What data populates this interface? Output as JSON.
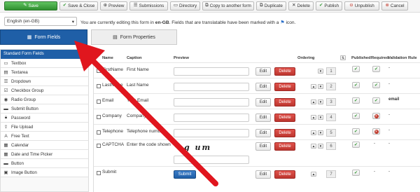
{
  "toolbar": {
    "save": "Save",
    "save_close": "Save & Close",
    "preview": "Preview",
    "submissions": "Submissions",
    "directory": "Directory",
    "copy": "Copy to another form",
    "duplicate": "Duplicate",
    "delete": "Delete",
    "publish": "Publish",
    "unpublish": "Unpublish",
    "cancel": "Cancel"
  },
  "language": {
    "selected": "English (en-GB)",
    "note_prefix": "You are currently editing this form in",
    "note_lang": "en-GB",
    "note_suffix": "Fields that are translatable have been marked with a",
    "note_icon_word": "icon."
  },
  "tabs": {
    "form_fields": "Form Fields",
    "form_properties": "Form Properties"
  },
  "sidebar": {
    "header": "Standard Form Fields",
    "items": [
      {
        "label": "Textbox",
        "icon": "textbox-icon"
      },
      {
        "label": "Textarea",
        "icon": "textarea-icon"
      },
      {
        "label": "Dropdown",
        "icon": "dropdown-icon"
      },
      {
        "label": "Checkbox Group",
        "icon": "checkbox-icon"
      },
      {
        "label": "Radio Group",
        "icon": "radio-icon"
      },
      {
        "label": "Submit Button",
        "icon": "submit-icon"
      },
      {
        "label": "Password",
        "icon": "lock-icon"
      },
      {
        "label": "File Upload",
        "icon": "upload-icon"
      },
      {
        "label": "Free Text",
        "icon": "font-icon"
      },
      {
        "label": "Calendar",
        "icon": "calendar-icon"
      },
      {
        "label": "Date and Time Picker",
        "icon": "datetime-icon"
      },
      {
        "label": "Button",
        "icon": "button-icon"
      },
      {
        "label": "Image Button",
        "icon": "image-icon"
      }
    ]
  },
  "table": {
    "headers": {
      "name": "Name",
      "caption": "Caption",
      "preview": "Preview",
      "ordering": "Ordering",
      "published": "Published",
      "required": "Required",
      "validation": "Validation Rule"
    },
    "buttons": {
      "edit": "Edit",
      "delete": "Delete"
    },
    "dash": "-",
    "rows": [
      {
        "name": "FirstName",
        "caption": "First Name",
        "order": "1",
        "published": true,
        "required": true,
        "validation": "-"
      },
      {
        "name": "LastName",
        "caption": "Last Name",
        "order": "2",
        "published": true,
        "required": true,
        "validation": "-"
      },
      {
        "name": "Email",
        "caption": "Your Email",
        "order": "3",
        "published": true,
        "required": true,
        "validation": "email"
      },
      {
        "name": "Company",
        "caption": "Company",
        "order": "4",
        "published": true,
        "required": false,
        "validation": "-"
      },
      {
        "name": "Telephone",
        "caption": "Telephone number",
        "order": "5",
        "published": true,
        "required": false,
        "validation": "-"
      },
      {
        "name": "CAPTCHA",
        "caption": "Enter the code shown",
        "order": "6",
        "published": true,
        "required": "-",
        "validation": "-",
        "captcha_text": "eg um"
      },
      {
        "name": "Submit",
        "caption": "",
        "order": "7",
        "published": true,
        "required": "-",
        "validation": "-",
        "submit_label": "Submit"
      }
    ]
  },
  "colors": {
    "primary": "#1f5fa7",
    "success": "#3a9a3a",
    "danger": "#bd362f",
    "annotation_arrow": "#e0161e"
  }
}
